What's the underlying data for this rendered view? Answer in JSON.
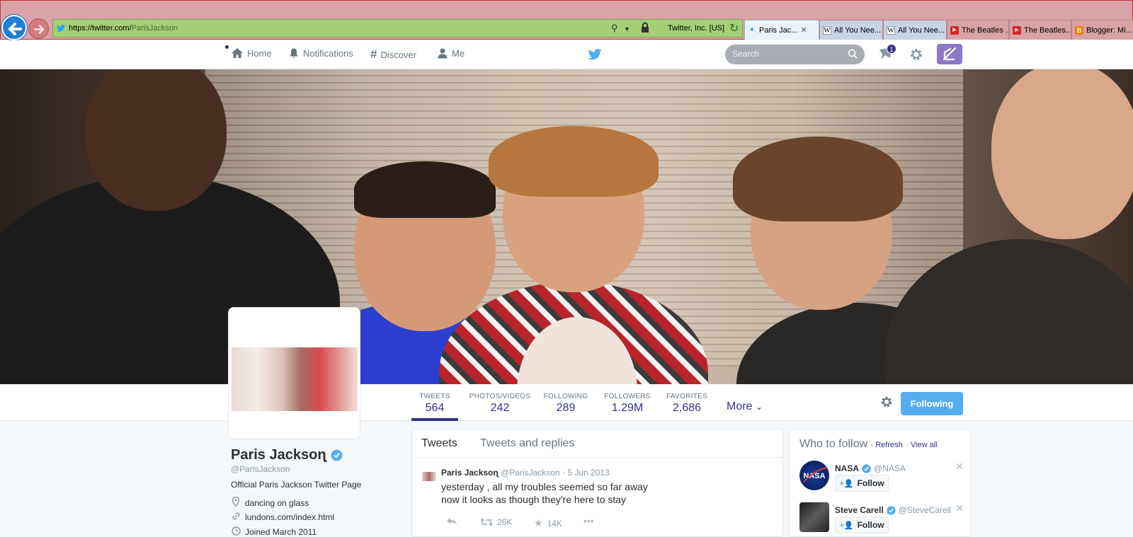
{
  "browser": {
    "url_main": "https://twitter.com/",
    "url_path": "ParisJackson",
    "site_identity": "Twitter, Inc. [US]",
    "tabs": [
      {
        "label": "Paris Jac...",
        "icon": "twitter-icon"
      },
      {
        "label": "All You Nee...",
        "icon": "wikipedia-icon"
      },
      {
        "label": "All You Nee...",
        "icon": "wikipedia-icon"
      },
      {
        "label": "The Beatles ...",
        "icon": "youtube-icon"
      },
      {
        "label": "The Beatles...",
        "icon": "youtube-icon"
      },
      {
        "label": "Blogger: Mi...",
        "icon": "blogger-icon"
      }
    ]
  },
  "nav": {
    "home": "Home",
    "notifications": "Notifications",
    "discover": "Discover",
    "me": "Me",
    "search_placeholder": "Search",
    "dm_count": "1"
  },
  "stats": [
    {
      "label": "TWEETS",
      "value": "564"
    },
    {
      "label": "PHOTOS/VIDEOS",
      "value": "242"
    },
    {
      "label": "FOLLOWING",
      "value": "289"
    },
    {
      "label": "FOLLOWERS",
      "value": "1.29M"
    },
    {
      "label": "FAVORITES",
      "value": "2,686"
    }
  ],
  "more_label": "More",
  "follow_button": "Following",
  "profile": {
    "name": "Paris Jacksoɳ",
    "handle": "@ParisJackson",
    "bio": "Official Paris Jackson Twitter Page",
    "location": "dancing on glass",
    "website": "lundons.com/index.html",
    "joined": "Joined March 2011"
  },
  "timeline": {
    "tab_tweets": "Tweets",
    "tab_replies": "Tweets and replies",
    "tweet": {
      "name": "Paris Jacksoɳ",
      "handle": "@ParisJackson",
      "date": "· 5 Jun 2013",
      "line1": "yesterday , all my troubles seemed so far away",
      "line2": "now it looks as though they're here to stay",
      "retweets": "26K",
      "favorites": "14K"
    }
  },
  "who_to_follow": {
    "title": "Who to follow",
    "refresh": "· Refresh",
    "view_all": "· View all",
    "follow_label": "Follow",
    "accounts": [
      {
        "name": "NASA",
        "handle": "@NASA"
      },
      {
        "name": "Steve Carell",
        "handle": "@SteveCarell"
      }
    ]
  },
  "colors": {
    "accent": "#35328a",
    "follow_blue": "#55acee",
    "browser_frame": "#d8a2a6",
    "address_bar": "#a3cf76"
  }
}
